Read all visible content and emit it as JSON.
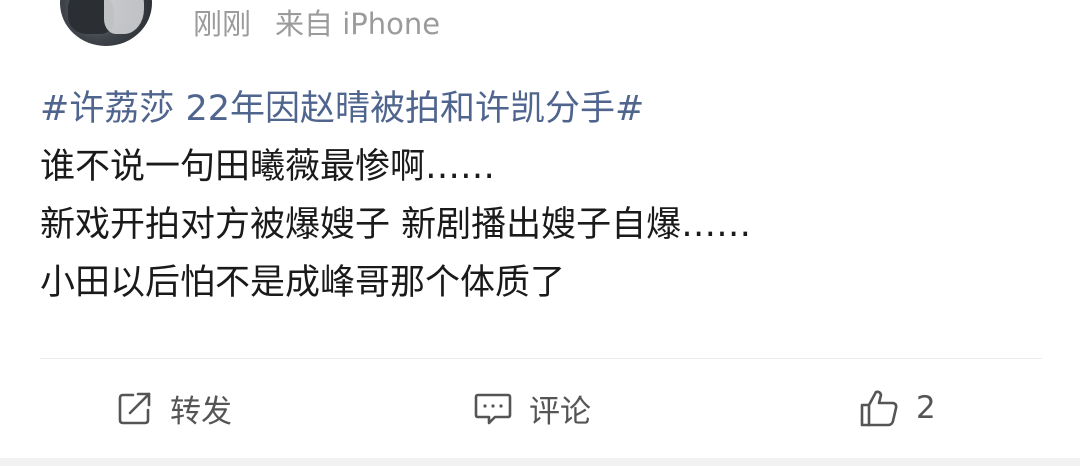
{
  "post": {
    "time": "刚刚",
    "source": "来自 iPhone",
    "topic": "#许荔莎 22年因赵晴被拍和许凯分手#",
    "lines": [
      "谁不说一句田曦薇最惨啊……",
      "新戏开拍对方被爆嫂子 新剧播出嫂子自爆……",
      "小田以后怕不是成峰哥那个体质了"
    ]
  },
  "actions": {
    "repost": {
      "icon": "share-square-icon",
      "label": "转发"
    },
    "comment": {
      "icon": "comment-icon",
      "label": "评论"
    },
    "like": {
      "icon": "thumbs-up-icon",
      "count": "2"
    }
  }
}
